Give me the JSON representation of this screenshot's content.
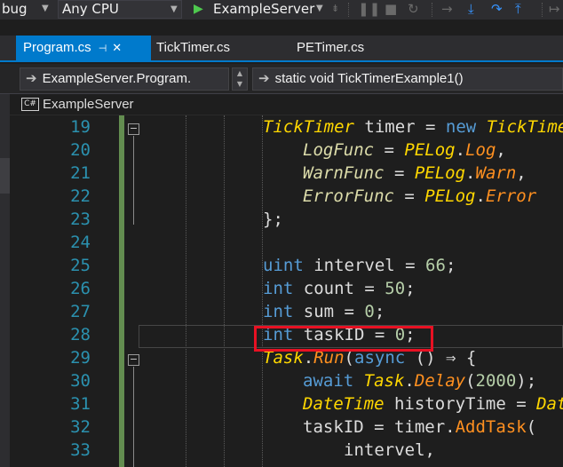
{
  "toolbar": {
    "config_label": "bug",
    "platform_label": "Any CPU",
    "start_label": "ExampleServer",
    "icons": [
      "play-icon",
      "pause-icon",
      "stop-icon",
      "restart-icon",
      "step-over-arrow-icon",
      "step-into-icon",
      "step-out-icon"
    ]
  },
  "tabs": [
    {
      "label": "Program.cs",
      "active": true,
      "pin": "⊣",
      "close": "✕"
    },
    {
      "label": "TickTimer.cs",
      "active": false
    },
    {
      "label": "PETimer.cs",
      "active": false
    }
  ],
  "navbar": {
    "class_label": "ExampleServer.Program.",
    "member_label": "static void TickTimerExample1()"
  },
  "scope": {
    "badge": "C#",
    "label": "ExampleServer"
  },
  "editor": {
    "lines": [
      {
        "num": "19",
        "tokens": [
          {
            "c": "ty",
            "t": "TickTimer"
          },
          {
            "c": "pl",
            "t": " timer = "
          },
          {
            "c": "kw",
            "t": "new"
          },
          {
            "c": "pl",
            "t": " "
          },
          {
            "c": "ty",
            "t": "TickTime"
          }
        ]
      },
      {
        "num": "20",
        "tokens": [
          {
            "c": "propi",
            "t": "LogFunc"
          },
          {
            "c": "pl",
            "t": " = "
          },
          {
            "c": "ty",
            "t": "PELog"
          },
          {
            "c": "pl",
            "t": "."
          },
          {
            "c": "meti",
            "t": "Log"
          },
          {
            "c": "pl",
            "t": ","
          }
        ]
      },
      {
        "num": "21",
        "tokens": [
          {
            "c": "propi",
            "t": "WarnFunc"
          },
          {
            "c": "pl",
            "t": " = "
          },
          {
            "c": "ty",
            "t": "PELog"
          },
          {
            "c": "pl",
            "t": "."
          },
          {
            "c": "meti",
            "t": "Warn"
          },
          {
            "c": "pl",
            "t": ","
          }
        ]
      },
      {
        "num": "22",
        "tokens": [
          {
            "c": "propi",
            "t": "ErrorFunc"
          },
          {
            "c": "pl",
            "t": " = "
          },
          {
            "c": "ty",
            "t": "PELog"
          },
          {
            "c": "pl",
            "t": "."
          },
          {
            "c": "meti",
            "t": "Error"
          }
        ]
      },
      {
        "num": "23",
        "tokens": [
          {
            "c": "pl",
            "t": "};"
          }
        ]
      },
      {
        "num": "24",
        "tokens": []
      },
      {
        "num": "25",
        "tokens": [
          {
            "c": "kw",
            "t": "uint"
          },
          {
            "c": "pl",
            "t": " intervel = "
          },
          {
            "c": "num",
            "t": "66"
          },
          {
            "c": "pl",
            "t": ";"
          }
        ]
      },
      {
        "num": "26",
        "tokens": [
          {
            "c": "kw",
            "t": "int"
          },
          {
            "c": "pl",
            "t": " count = "
          },
          {
            "c": "num",
            "t": "50"
          },
          {
            "c": "pl",
            "t": ";"
          }
        ]
      },
      {
        "num": "27",
        "tokens": [
          {
            "c": "kw",
            "t": "int"
          },
          {
            "c": "pl",
            "t": " sum = "
          },
          {
            "c": "num",
            "t": "0"
          },
          {
            "c": "pl",
            "t": ";"
          }
        ]
      },
      {
        "num": "28",
        "tokens": [
          {
            "c": "kw",
            "t": "int"
          },
          {
            "c": "pl",
            "t": " taskID = "
          },
          {
            "c": "num",
            "t": "0"
          },
          {
            "c": "pl",
            "t": ";"
          }
        ]
      },
      {
        "num": "29",
        "tokens": [
          {
            "c": "ty",
            "t": "Task"
          },
          {
            "c": "pl",
            "t": "."
          },
          {
            "c": "meti",
            "t": "Run"
          },
          {
            "c": "pl",
            "t": "("
          },
          {
            "c": "kw",
            "t": "async"
          },
          {
            "c": "pl",
            "t": " () ⇒ {"
          }
        ]
      },
      {
        "num": "30",
        "tokens": [
          {
            "c": "kw",
            "t": "await"
          },
          {
            "c": "pl",
            "t": " "
          },
          {
            "c": "ty",
            "t": "Task"
          },
          {
            "c": "pl",
            "t": "."
          },
          {
            "c": "meti",
            "t": "Delay"
          },
          {
            "c": "pl",
            "t": "("
          },
          {
            "c": "num",
            "t": "2000"
          },
          {
            "c": "pl",
            "t": ");"
          }
        ]
      },
      {
        "num": "31",
        "tokens": [
          {
            "c": "ty",
            "t": "DateTime"
          },
          {
            "c": "pl",
            "t": " historyTime = "
          },
          {
            "c": "ty",
            "t": "Dat"
          }
        ]
      },
      {
        "num": "32",
        "tokens": [
          {
            "c": "pl",
            "t": "taskID = timer."
          },
          {
            "c": "met",
            "t": "AddTask"
          },
          {
            "c": "pl",
            "t": "("
          }
        ]
      },
      {
        "num": "33",
        "tokens": [
          {
            "c": "pl",
            "t": "intervel,"
          }
        ]
      }
    ]
  },
  "colors": {
    "accent": "#007acc",
    "highlight": "#e81123",
    "line_number": "#2b91af",
    "change_bar": "#6a9955"
  }
}
